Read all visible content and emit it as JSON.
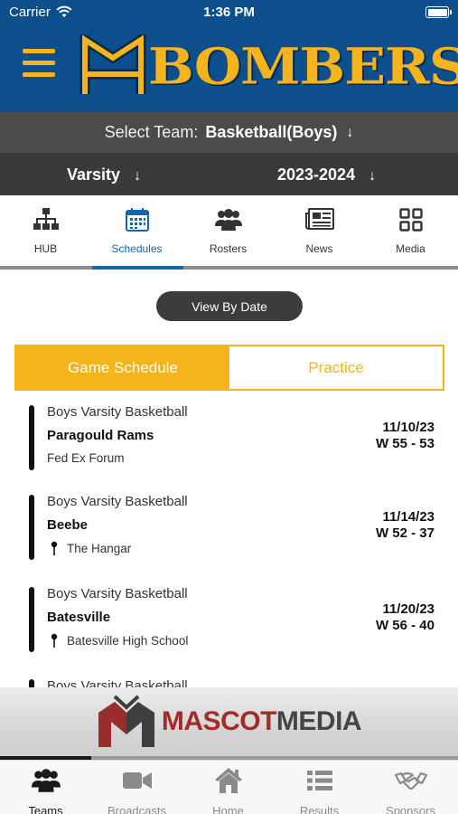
{
  "status_bar": {
    "carrier": "Carrier",
    "time": "1:36 PM"
  },
  "brand": {
    "logo_text": "BOMBERS",
    "primary": "#0c4f8c",
    "accent": "#f5b41c"
  },
  "team_selector": {
    "label": "Select Team:",
    "value": "Basketball(Boys)"
  },
  "filters": {
    "level": "Varsity",
    "season": "2023-2024"
  },
  "top_tabs": [
    {
      "label": "HUB",
      "icon": "org-chart-icon"
    },
    {
      "label": "Schedules",
      "icon": "calendar-icon"
    },
    {
      "label": "Rosters",
      "icon": "people-icon"
    },
    {
      "label": "News",
      "icon": "newspaper-icon"
    },
    {
      "label": "Media",
      "icon": "grid-icon"
    }
  ],
  "active_top_tab": "Schedules",
  "view_button": "View By Date",
  "segments": {
    "left": "Game Schedule",
    "right": "Practice"
  },
  "games": [
    {
      "sport": "Boys Varsity Basketball",
      "opponent": "Paragould Rams",
      "venue": "Fed Ex Forum",
      "date": "11/10/23",
      "result": "W 55 - 53"
    },
    {
      "sport": "Boys Varsity Basketball",
      "opponent": "Beebe",
      "venue": "The Hangar",
      "date": "11/14/23",
      "result": "W 52 - 37"
    },
    {
      "sport": "Boys Varsity Basketball",
      "opponent": "Batesville",
      "venue": "Batesville High School",
      "date": "11/20/23",
      "result": "W 56 - 40"
    },
    {
      "sport": "Boys Varsity Basketball"
    }
  ],
  "sponsor": {
    "word1": "MASCOT",
    "word2": "MEDIA"
  },
  "banner_progress": 0.2,
  "bottom_tabs": [
    {
      "label": "Teams",
      "icon": "people-icon"
    },
    {
      "label": "Broadcasts",
      "icon": "video-camera-icon"
    },
    {
      "label": "Home",
      "icon": "home-icon"
    },
    {
      "label": "Results",
      "icon": "list-icon"
    },
    {
      "label": "Sponsors",
      "icon": "handshake-icon"
    }
  ],
  "active_bottom_tab": "Teams"
}
